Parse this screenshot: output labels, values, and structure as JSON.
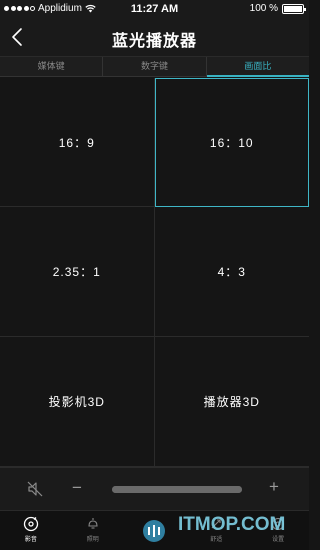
{
  "status_bar": {
    "carrier": "Applidium",
    "time": "11:27 AM",
    "battery": "100 %",
    "battery_level": 1.0
  },
  "nav": {
    "title": "蓝光播放器",
    "back_icon": "chevron-left-icon"
  },
  "tabs": [
    {
      "label": "媒体键",
      "active": false
    },
    {
      "label": "数字键",
      "active": false
    },
    {
      "label": "画面比",
      "active": true
    }
  ],
  "aspect_options": [
    {
      "label": "16：9",
      "selected": false
    },
    {
      "label": "16：10",
      "selected": true
    },
    {
      "label": "2.35：1",
      "selected": false
    },
    {
      "label": "4：3",
      "selected": false
    },
    {
      "label": "投影机3D",
      "selected": false
    },
    {
      "label": "播放器3D",
      "selected": false
    }
  ],
  "volume": {
    "mute_icon": "speaker-muted-icon",
    "minus": "−",
    "plus": "+",
    "level": 1.0
  },
  "bottom_tabs": [
    {
      "label": "影音",
      "icon": "disc-icon",
      "active": true
    },
    {
      "label": "照明",
      "icon": "lamp-icon",
      "active": false
    },
    {
      "label": "",
      "icon": "app-logo-icon",
      "active": false
    },
    {
      "label": "舒适",
      "icon": "comfort-icon",
      "active": false
    },
    {
      "label": "设置",
      "icon": "settings-icon",
      "active": false
    }
  ],
  "watermark": "ITMOP.COM",
  "colors": {
    "accent": "#39b4c4",
    "background": "#151515"
  }
}
